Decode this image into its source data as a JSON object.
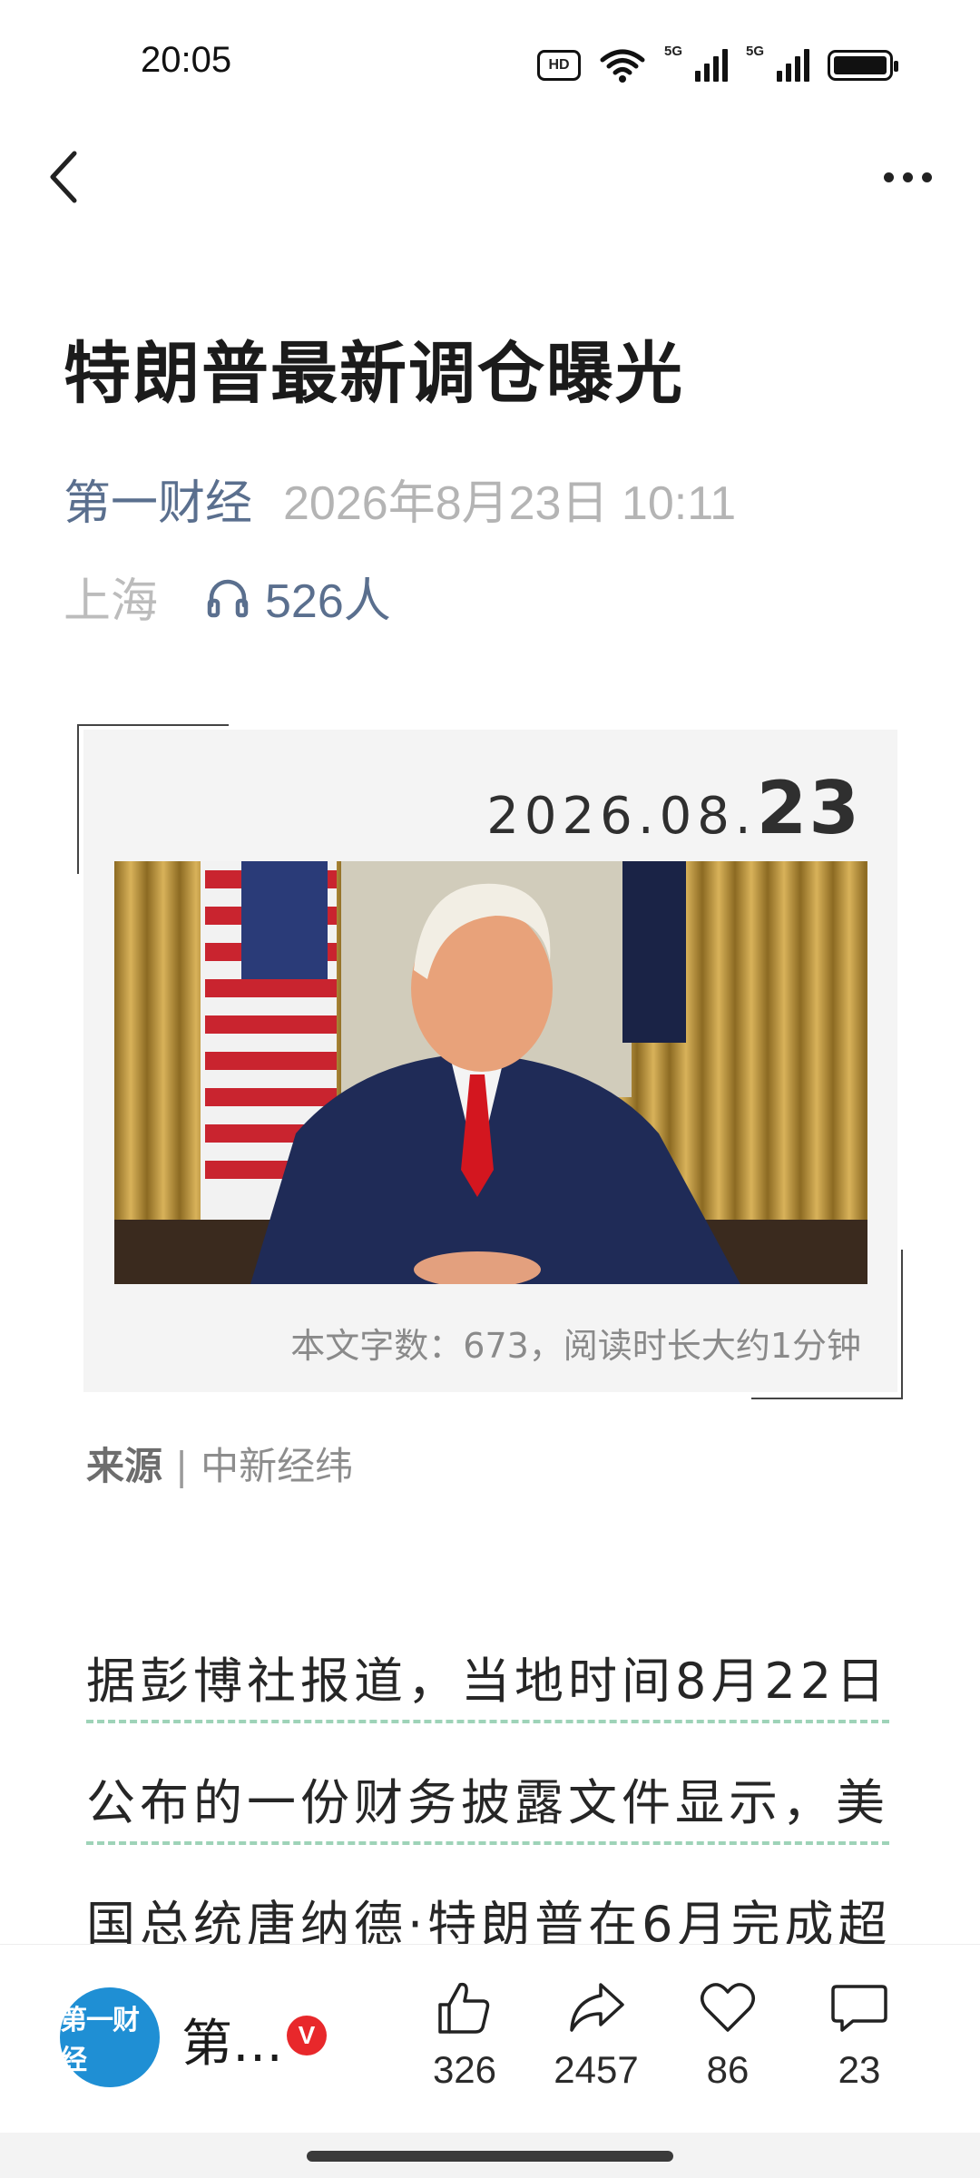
{
  "status_bar": {
    "time": "20:05",
    "icons": [
      "hd-icon",
      "wifi-icon",
      "signal-5g-icon",
      "signal-5g-icon",
      "battery-icon"
    ],
    "hd_label": "HD",
    "network_label": "5G"
  },
  "nav": {
    "back_icon": "chevron-left-icon",
    "more_icon": "more-horizontal-icon"
  },
  "article": {
    "title": "特朗普最新调仓曝光",
    "source_name": "第一财经",
    "publish_time": "2026年8月23日 10:11",
    "location": "上海",
    "listeners": "526人"
  },
  "card": {
    "date_prefix": "2026.08.",
    "date_day": "23",
    "word_count_text": "本文字数：673，阅读时长大约1分钟"
  },
  "source_line": {
    "label": "来源",
    "separator": "|",
    "value": "中新经纬"
  },
  "body": {
    "lines": [
      "据彭博社报道，当地时间8月22日",
      "公布的一份财务披露文件显示，美",
      "国总统唐纳德·特朗普在6月完成超"
    ]
  },
  "bottom_bar": {
    "author_logo_text": "第一财经",
    "author_name": "第…",
    "verified_badge": "V",
    "actions": {
      "like_count": "326",
      "share_count": "2457",
      "favorite_count": "86",
      "comment_count": "23"
    }
  },
  "colors": {
    "accent_blue": "#5a6f8e",
    "meta_gray": "#b4b4b4",
    "verified_red": "#e8282b",
    "logo_blue": "#1f8fd4",
    "underline_green": "#9ed3b8"
  }
}
